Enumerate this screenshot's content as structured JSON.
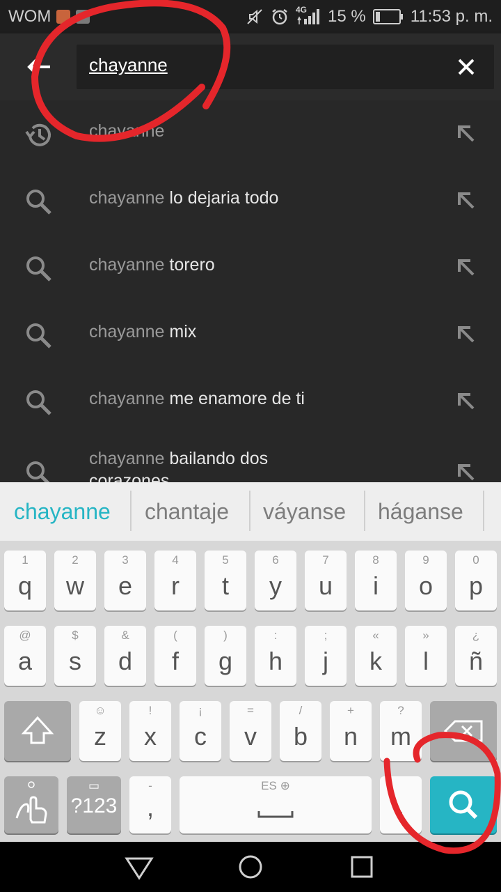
{
  "status_bar": {
    "carrier": "WOM",
    "network": "4G",
    "battery": "15 %",
    "time": "11:53 p. m."
  },
  "search": {
    "query": "chayanne"
  },
  "suggestions": [
    {
      "type": "history",
      "prefix": "chayanne",
      "rest": ""
    },
    {
      "type": "search",
      "prefix": "chayanne",
      "rest": " lo dejaria todo"
    },
    {
      "type": "search",
      "prefix": "chayanne",
      "rest": " torero"
    },
    {
      "type": "search",
      "prefix": "chayanne",
      "rest": " mix"
    },
    {
      "type": "search",
      "prefix": "chayanne",
      "rest": " me enamore de ti"
    },
    {
      "type": "search",
      "prefix": "chayanne",
      "rest": " bailando dos",
      "line2": "corazones"
    }
  ],
  "word_suggestions": [
    "chayanne",
    "chantaje",
    "váyanse",
    "háganse"
  ],
  "keyboard": {
    "row1": [
      {
        "main": "q",
        "sub": "1"
      },
      {
        "main": "w",
        "sub": "2"
      },
      {
        "main": "e",
        "sub": "3"
      },
      {
        "main": "r",
        "sub": "4"
      },
      {
        "main": "t",
        "sub": "5"
      },
      {
        "main": "y",
        "sub": "6"
      },
      {
        "main": "u",
        "sub": "7"
      },
      {
        "main": "i",
        "sub": "8"
      },
      {
        "main": "o",
        "sub": "9"
      },
      {
        "main": "p",
        "sub": "0"
      }
    ],
    "row2": [
      {
        "main": "a",
        "sub": "@"
      },
      {
        "main": "s",
        "sub": "$"
      },
      {
        "main": "d",
        "sub": "&"
      },
      {
        "main": "f",
        "sub": "("
      },
      {
        "main": "g",
        "sub": ")"
      },
      {
        "main": "h",
        "sub": ":"
      },
      {
        "main": "j",
        "sub": ";"
      },
      {
        "main": "k",
        "sub": "«"
      },
      {
        "main": "l",
        "sub": "»"
      },
      {
        "main": "ñ",
        "sub": "¿"
      }
    ],
    "row3": [
      {
        "main": "z",
        "sub": "☺"
      },
      {
        "main": "x",
        "sub": "!"
      },
      {
        "main": "c",
        "sub": "¡"
      },
      {
        "main": "v",
        "sub": "="
      },
      {
        "main": "b",
        "sub": "/"
      },
      {
        "main": "n",
        "sub": "+"
      },
      {
        "main": "m",
        "sub": "?"
      }
    ],
    "symbols_label": "?123",
    "comma_main": ",",
    "comma_sub": "-",
    "space_lang": "ES",
    "period_main": "."
  },
  "colors": {
    "accent": "#26b5c4",
    "annotation": "#e5262b"
  }
}
